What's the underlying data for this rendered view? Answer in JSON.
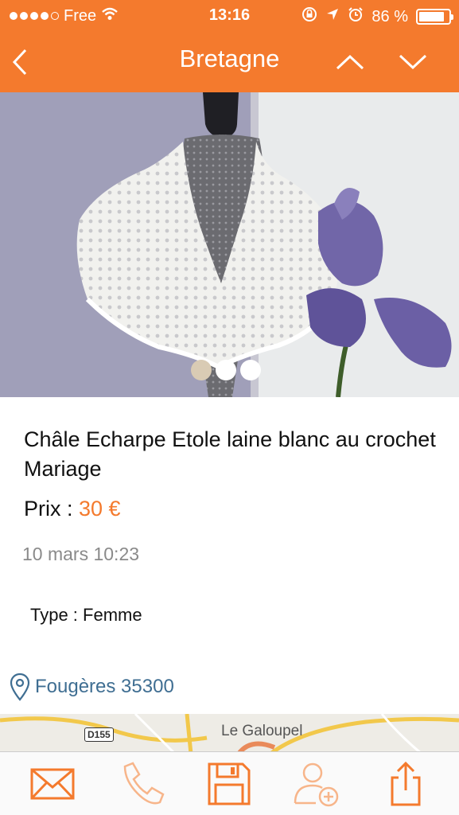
{
  "status_bar": {
    "carrier": "Free",
    "time": "13:16",
    "battery_percent": "86 %",
    "battery_level": 0.86
  },
  "nav": {
    "title": "Bretagne",
    "back_icon": "chevron-left-icon",
    "prev_icon": "chevron-up-icon",
    "next_icon": "chevron-down-icon"
  },
  "photo": {
    "pages": 3,
    "active_page": 1
  },
  "listing": {
    "title": "Châle Echarpe Etole laine blanc au crochet Mariage",
    "price_label": "Prix : ",
    "price_value": "30 €",
    "date": "10 mars 10:23",
    "type": "Type : Femme",
    "location": "Fougères 35300"
  },
  "map": {
    "place": "Le Galoupel",
    "road": "D155"
  },
  "toolbar": {
    "items": [
      "mail-icon",
      "phone-icon",
      "save-icon",
      "add-contact-icon",
      "share-icon"
    ]
  },
  "colors": {
    "accent": "#f47a2d",
    "link": "#3f6e92"
  }
}
